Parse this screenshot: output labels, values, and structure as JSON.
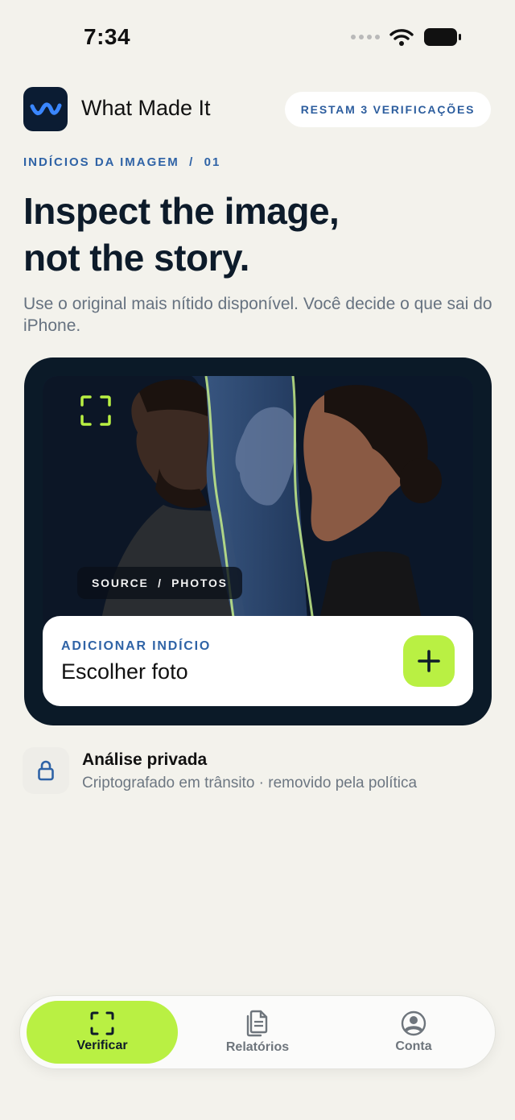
{
  "status": {
    "time": "7:34"
  },
  "header": {
    "app_name": "What Made It",
    "checks_remaining": "RESTAM 3 VERIFICAÇÕES"
  },
  "intro": {
    "eyebrow": "INDÍCIOS DA IMAGEM  /  01",
    "headline_line1": "Inspect the image,",
    "headline_line2": "not the story.",
    "subtext": "Use o original mais nítido disponível. Você decide o que sai do iPhone."
  },
  "card": {
    "source_label": "SOURCE  /  PHOTOS",
    "add_eyebrow": "ADICIONAR INDÍCIO",
    "add_title": "Escolher foto"
  },
  "privacy": {
    "title": "Análise privada",
    "subtitle": "Criptografado em trânsito · removido pela política"
  },
  "tabs": [
    {
      "label": "Verificar",
      "icon": "scan-icon",
      "active": true
    },
    {
      "label": "Relatórios",
      "icon": "documents-icon",
      "active": false
    },
    {
      "label": "Conta",
      "icon": "account-icon",
      "active": false
    }
  ],
  "colors": {
    "accent": "#b9f043",
    "brand_blue": "#2f63a6",
    "card_dark": "#0b1a28",
    "background": "#f3f2ec"
  }
}
